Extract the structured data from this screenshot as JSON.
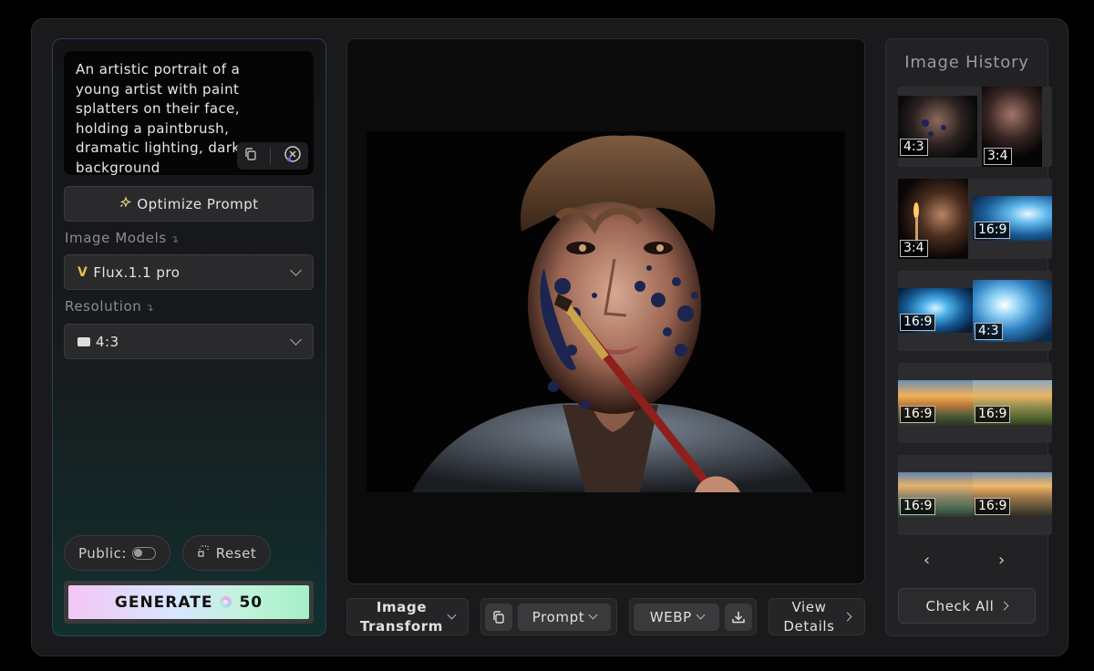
{
  "prompt": {
    "text": "An artistic portrait of a young artist with paint splatters on their face, holding a paintbrush, dramatic lighting, dark background",
    "copy_icon": "copy-icon",
    "clear_icon": "close-circle-icon"
  },
  "optimize_label": "Optimize Prompt",
  "models": {
    "label": "Image Models",
    "selected": "Flux.1.1 pro",
    "badge": "V"
  },
  "resolution": {
    "label": "Resolution",
    "selected": "4:3"
  },
  "public_label": "Public:",
  "reset_label": "Reset",
  "generate": {
    "label": "GENERATE",
    "credits": "50"
  },
  "toolbar": {
    "transform_label_1": "Image",
    "transform_label_2": "Transform",
    "prompt_label": "Prompt",
    "format_label": "WEBP",
    "details_label_1": "View",
    "details_label_2": "Details"
  },
  "history": {
    "title": "Image History",
    "rows": [
      [
        "4:3",
        "3:4"
      ],
      [
        "3:4",
        "16:9"
      ],
      [
        "16:9",
        "4:3"
      ],
      [
        "16:9",
        "16:9"
      ],
      [
        "16:9",
        "16:9"
      ]
    ],
    "prev": "‹",
    "next": "›",
    "check_all": "Check All"
  },
  "colors": {
    "accent_border": "#27415e",
    "generate_start": "#f3c7f4",
    "generate_end": "#a3f0c8"
  }
}
